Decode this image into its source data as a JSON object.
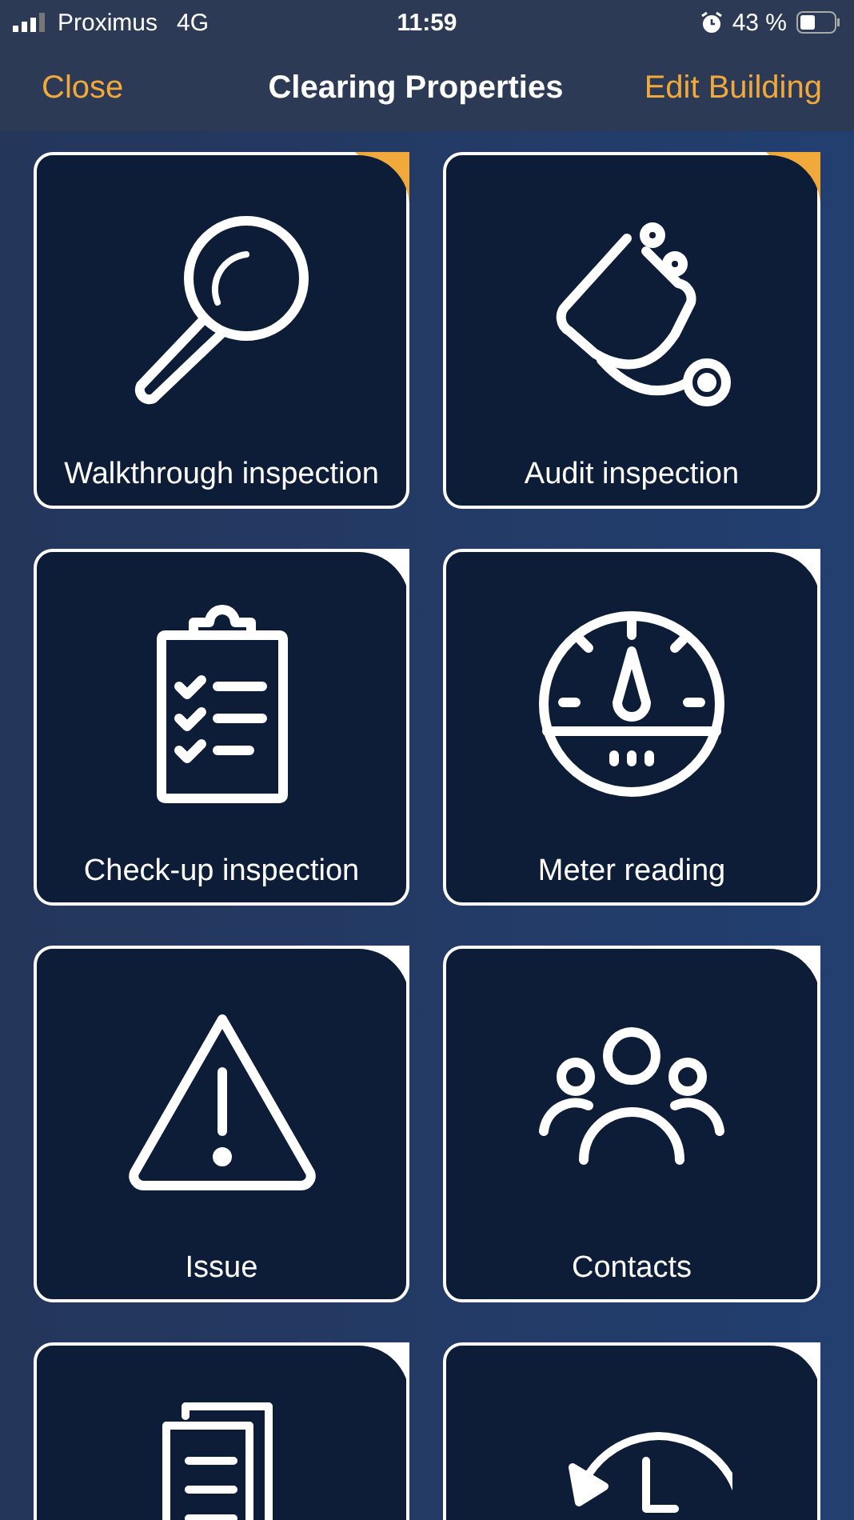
{
  "status_bar": {
    "carrier": "Proximus",
    "network": "4G",
    "time": "11:59",
    "battery": "43 %"
  },
  "nav": {
    "left": "Close",
    "title": "Clearing Properties",
    "right": "Edit Building"
  },
  "tiles": [
    {
      "label": "Walkthrough inspection",
      "color": "#f0a93a"
    },
    {
      "label": "Audit inspection",
      "color": "#f0a93a"
    },
    {
      "label": "Check-up inspection",
      "color": "#ffffff"
    },
    {
      "label": "Meter reading",
      "color": "#ffffff"
    },
    {
      "label": "Issue",
      "color": "#ffffff"
    },
    {
      "label": "Contacts",
      "color": "#ffffff"
    },
    {
      "color": "#ffffff"
    },
    {
      "color": "#ffffff"
    }
  ]
}
